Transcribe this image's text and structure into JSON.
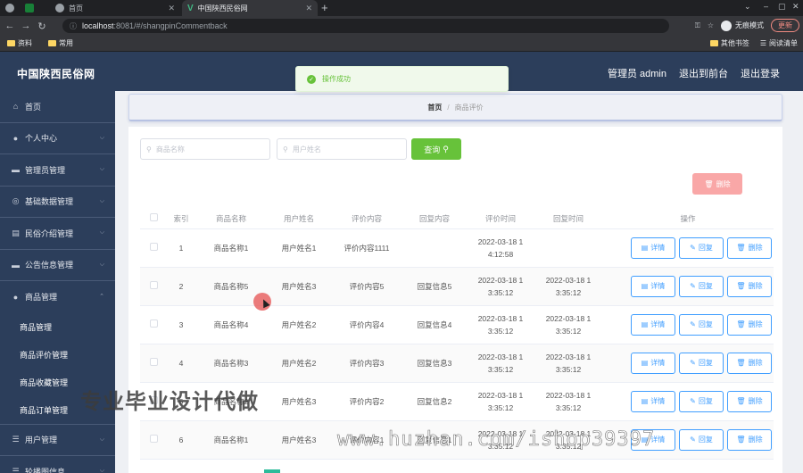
{
  "browser": {
    "tabs": [
      {
        "label": ""
      },
      {
        "label": "首页"
      },
      {
        "label": "中国陕西民俗网"
      }
    ],
    "url_host": "localhost",
    "url_rest": ":8081/#/shangpinCommentback",
    "incognito_label": "无痕模式",
    "update_label": "更新",
    "bookmarks": [
      "资料",
      "常用"
    ],
    "bookmarks_right": [
      "其他书签",
      "阅读清单"
    ]
  },
  "header": {
    "title": "中国陕西民俗网",
    "admin": "管理员 admin",
    "back_front": "退出到前台",
    "logout": "退出登录"
  },
  "toast": {
    "message": "操作成功"
  },
  "sidebar": {
    "items": [
      {
        "label": "首页",
        "icon": "home-icon"
      },
      {
        "label": "个人中心",
        "icon": "user-icon"
      },
      {
        "label": "管理员管理",
        "icon": "monitor-icon"
      },
      {
        "label": "基础数据管理",
        "icon": "globe-icon"
      },
      {
        "label": "民俗介绍管理",
        "icon": "document-icon"
      },
      {
        "label": "公告信息管理",
        "icon": "monitor-icon"
      },
      {
        "label": "商品管理",
        "icon": "user-icon"
      }
    ],
    "sub_items": [
      "商品管理",
      "商品评价管理",
      "商品收藏管理",
      "商品订单管理"
    ],
    "bottom_items": [
      {
        "label": "用户管理",
        "icon": "menu-icon"
      },
      {
        "label": "轮播图信息",
        "icon": "menu-icon"
      }
    ]
  },
  "breadcrumb": {
    "home": "首页",
    "current": "商品评价"
  },
  "search": {
    "product_placeholder": "商品名称",
    "user_placeholder": "用户姓名",
    "query_label": "查询",
    "delete_label": "删除"
  },
  "table": {
    "headers": [
      "索引",
      "商品名称",
      "用户姓名",
      "评价内容",
      "回复内容",
      "评价时间",
      "回复时间",
      "操作"
    ],
    "rows": [
      {
        "idx": "1",
        "product": "商品名称1",
        "user": "用户姓名1",
        "content": "评价内容1111",
        "reply": "",
        "time_a": "2022-03-18 1",
        "time_b": "4:12:58",
        "rtime_a": "",
        "rtime_b": ""
      },
      {
        "idx": "2",
        "product": "商品名称5",
        "user": "用户姓名3",
        "content": "评价内容5",
        "reply": "回复信息5",
        "time_a": "2022-03-18 1",
        "time_b": "3:35:12",
        "rtime_a": "2022-03-18 1",
        "rtime_b": "3:35:12"
      },
      {
        "idx": "3",
        "product": "商品名称4",
        "user": "用户姓名2",
        "content": "评价内容4",
        "reply": "回复信息4",
        "time_a": "2022-03-18 1",
        "time_b": "3:35:12",
        "rtime_a": "2022-03-18 1",
        "rtime_b": "3:35:12"
      },
      {
        "idx": "4",
        "product": "商品名称3",
        "user": "用户姓名2",
        "content": "评价内容3",
        "reply": "回复信息3",
        "time_a": "2022-03-18 1",
        "time_b": "3:35:12",
        "rtime_a": "2022-03-18 1",
        "rtime_b": "3:35:12"
      },
      {
        "idx": "5",
        "product": "商品名称2",
        "user": "用户姓名3",
        "content": "评价内容2",
        "reply": "回复信息2",
        "time_a": "2022-03-18 1",
        "time_b": "3:35:12",
        "rtime_a": "2022-03-18 1",
        "rtime_b": "3:35:12"
      },
      {
        "idx": "6",
        "product": "商品名称1",
        "user": "用户姓名3",
        "content": "评价内容1",
        "reply": "回复信息1",
        "time_a": "2022-03-18 1",
        "time_b": "3:35:12",
        "rtime_a": "2022-03-18 1",
        "rtime_b": "3:35:12"
      }
    ],
    "actions": {
      "detail": "详情",
      "reply": "回复",
      "delete": "删除"
    }
  },
  "watermarks": {
    "slogan": "专业毕业设计代做",
    "site": "www.huzhan.com/ishop39397"
  }
}
